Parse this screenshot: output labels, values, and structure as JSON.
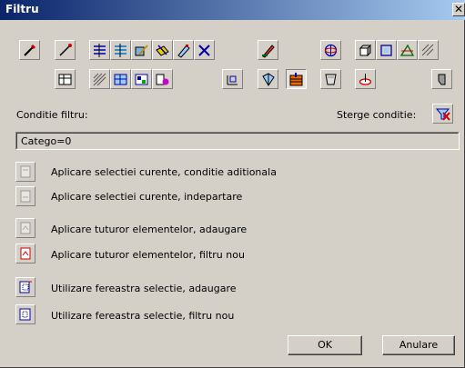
{
  "window": {
    "title": "Filtru",
    "close_glyph": "✕"
  },
  "toolbar": {
    "row1_icons": [
      "eyedropper-icon",
      "line-tool-icon",
      "text-lines-icon",
      "text-lines-alt-icon",
      "pencil-pattern-icon",
      "pencil-yellow-icon",
      "pencil-variant-icon",
      "x-pattern-icon",
      "paint-pen-icon",
      "sphere-icon",
      "shape-3d-icon",
      "shape-frame-icon",
      "shape-cut-icon",
      "hatch-icon"
    ],
    "row2_icons": [
      "table-icon",
      "hatch-diagonal-icon",
      "pattern-grid-icon",
      "pattern-fill-icon",
      "shape-color-icon",
      "dimension-icon",
      "wire-shape-icon",
      "fill-selected-icon",
      "glass-shape-icon",
      "clip-shape-icon",
      "solid-shape-icon"
    ]
  },
  "filter": {
    "condition_label": "Conditie filtru:",
    "clear_label": "Sterge conditie:",
    "value": "Catego=0"
  },
  "actions": [
    {
      "icon": "select-add-icon",
      "label": "Aplicare selectiei curente, conditie aditionala"
    },
    {
      "icon": "select-separate-icon",
      "label": "Aplicare selectiei curente, indepartare"
    },
    {
      "icon": "all-add-icon",
      "label": "Aplicare tuturor elementelor, adaugare"
    },
    {
      "icon": "all-new-icon",
      "label": "Aplicare tuturor elementelor, filtru nou"
    },
    {
      "icon": "window-add-icon",
      "label": "Utilizare fereastra selectie, adaugare"
    },
    {
      "icon": "window-new-icon",
      "label": "Utilizare fereastra selectie, filtru nou"
    }
  ],
  "buttons": {
    "ok": "OK",
    "cancel": "Anulare"
  },
  "colors": {
    "title_start": "#0a246a",
    "title_end": "#a6caf0",
    "face": "#d4d0c8"
  }
}
